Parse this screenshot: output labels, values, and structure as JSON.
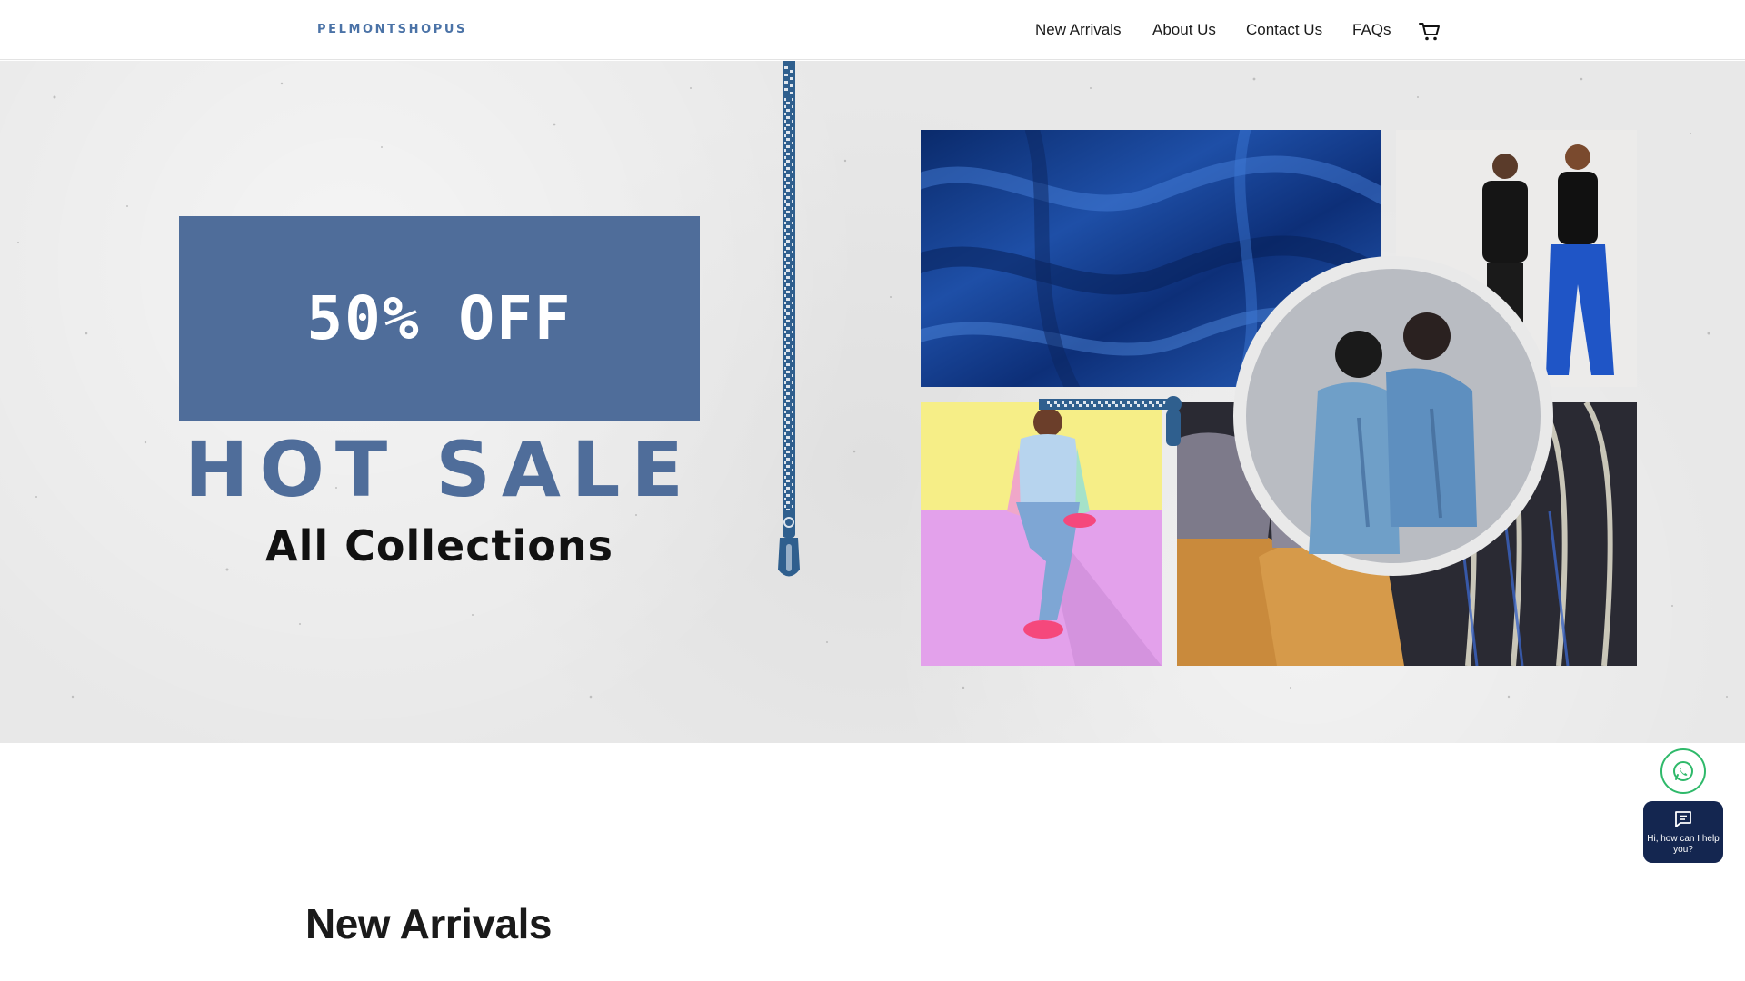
{
  "header": {
    "logo": "PELMONTSHOPUS",
    "nav": [
      "New Arrivals",
      "About Us",
      "Contact Us",
      "FAQs"
    ],
    "cart_icon": "cart-icon"
  },
  "hero": {
    "discount": "50% OFF",
    "headline": "HOT SALE",
    "subheadline": "All Collections",
    "accent_color": "#4f6d9a"
  },
  "main": {
    "section_title": "New Arrivals"
  },
  "widgets": {
    "whatsapp_icon": "whatsapp-icon",
    "chat_icon": "chat-icon",
    "chat_label": "Hi, how can I help you?"
  }
}
